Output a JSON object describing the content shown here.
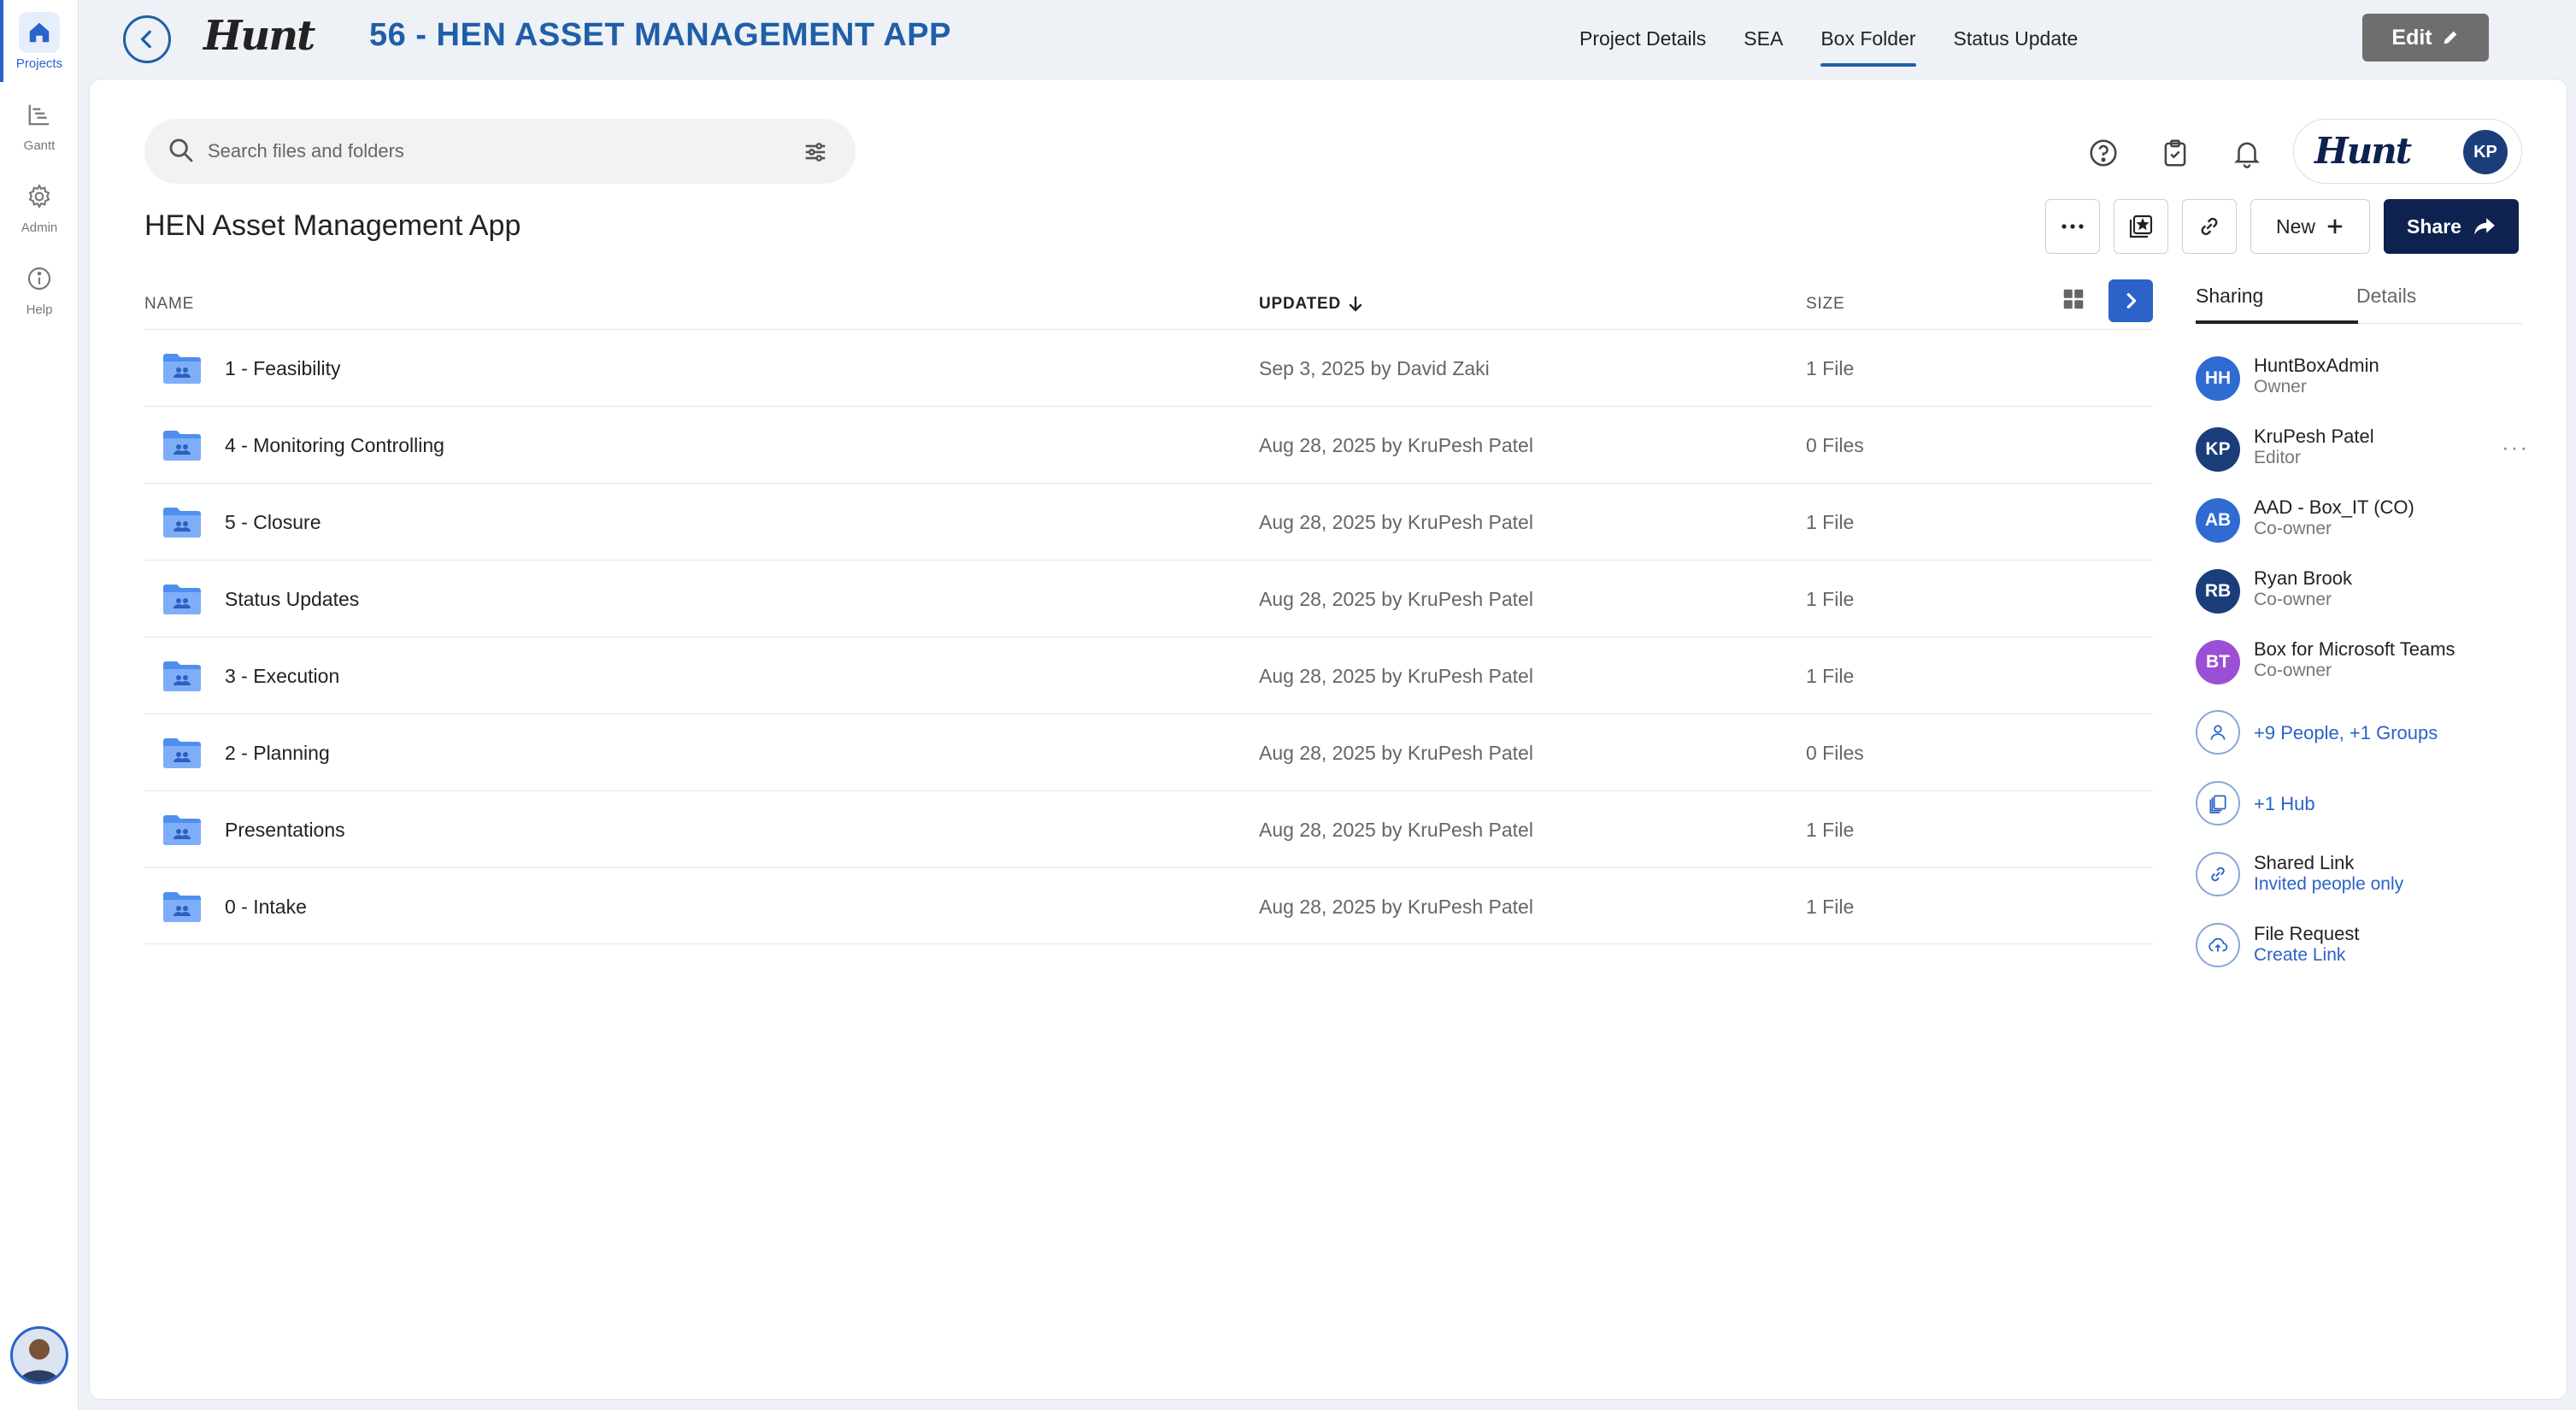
{
  "nav": {
    "items": [
      {
        "label": "Projects",
        "icon": "home-icon"
      },
      {
        "label": "Gantt",
        "icon": "gantt-icon"
      },
      {
        "label": "Admin",
        "icon": "gear-icon"
      },
      {
        "label": "Help",
        "icon": "info-icon"
      }
    ]
  },
  "header": {
    "brand": "Hunt",
    "project_title": "56 - HEN ASSET MANAGEMENT APP",
    "tabs": [
      "Project Details",
      "SEA",
      "Box Folder",
      "Status Update"
    ],
    "active_tab": "Box Folder",
    "edit_label": "Edit"
  },
  "search": {
    "placeholder": "Search files and folders"
  },
  "account": {
    "brand": "Hunt",
    "initials": "KP"
  },
  "folder": {
    "title": "HEN Asset Management App",
    "new_label": "New",
    "share_label": "Share"
  },
  "table": {
    "columns": {
      "name": "NAME",
      "updated": "UPDATED",
      "size": "SIZE"
    },
    "sort": "updated-desc",
    "rows": [
      {
        "name": "1 - Feasibility",
        "updated": "Sep 3, 2025 by David Zaki",
        "size": "1 File"
      },
      {
        "name": "4 - Monitoring Controlling",
        "updated": "Aug 28, 2025 by KruPesh Patel",
        "size": "0 Files"
      },
      {
        "name": "5 - Closure",
        "updated": "Aug 28, 2025 by KruPesh Patel",
        "size": "1 File"
      },
      {
        "name": "Status Updates",
        "updated": "Aug 28, 2025 by KruPesh Patel",
        "size": "1 File"
      },
      {
        "name": "3 - Execution",
        "updated": "Aug 28, 2025 by KruPesh Patel",
        "size": "1 File"
      },
      {
        "name": "2 - Planning",
        "updated": "Aug 28, 2025 by KruPesh Patel",
        "size": "0 Files"
      },
      {
        "name": "Presentations",
        "updated": "Aug 28, 2025 by KruPesh Patel",
        "size": "1 File"
      },
      {
        "name": "0 - Intake",
        "updated": "Aug 28, 2025 by KruPesh Patel",
        "size": "1 File"
      }
    ]
  },
  "sidebar": {
    "tabs": [
      "Sharing",
      "Details"
    ],
    "collaborators": [
      {
        "initials": "HH",
        "name": "HuntBoxAdmin",
        "role": "Owner",
        "color": "#2f6bd1"
      },
      {
        "initials": "KP",
        "name": "KruPesh Patel",
        "role": "Editor",
        "color": "#1b3e7b"
      },
      {
        "initials": "AB",
        "name": "AAD - Box_IT (CO)",
        "role": "Co-owner",
        "color": "#2f6bd1"
      },
      {
        "initials": "RB",
        "name": "Ryan Brook",
        "role": "Co-owner",
        "color": "#1b3e7b"
      },
      {
        "initials": "BT",
        "name": "Box for Microsoft Teams",
        "role": "Co-owner",
        "color": "#9b4fd6"
      }
    ],
    "more_people": "+9 People, +1 Groups",
    "hub": "+1 Hub",
    "shared_link": {
      "title": "Shared Link",
      "value": "Invited people only"
    },
    "file_request": {
      "title": "File Request",
      "value": "Create Link"
    }
  },
  "colors": {
    "accent": "#2b63c8",
    "navy": "#0e2250",
    "title_blue": "#1f5fa8"
  }
}
